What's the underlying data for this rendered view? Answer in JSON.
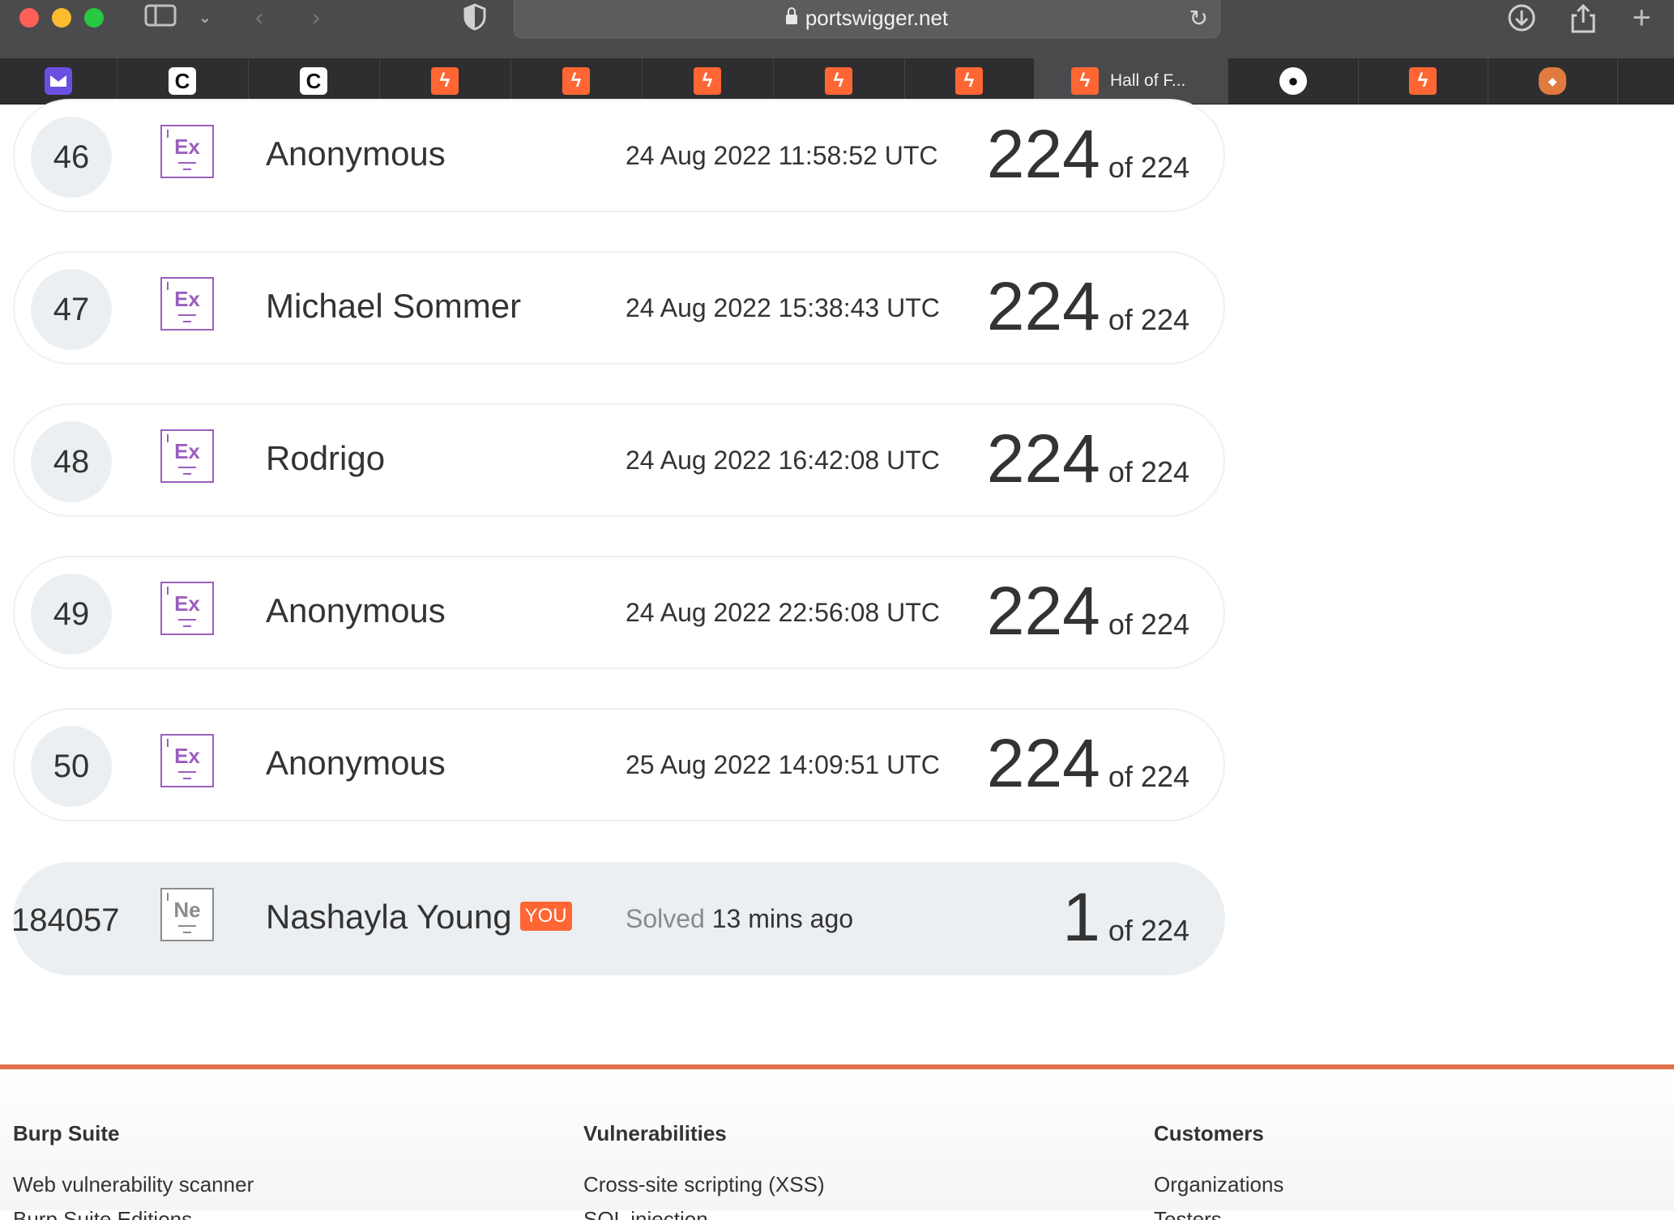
{
  "browser": {
    "url": "portswigger.net",
    "tabs": [
      {
        "icon": "mail-icon",
        "title": ""
      },
      {
        "icon": "c-logo-icon",
        "title": ""
      },
      {
        "icon": "c-logo-icon",
        "title": ""
      },
      {
        "icon": "burp-bolt-icon",
        "title": ""
      },
      {
        "icon": "burp-bolt-icon",
        "title": ""
      },
      {
        "icon": "burp-bolt-icon",
        "title": ""
      },
      {
        "icon": "burp-bolt-icon",
        "title": ""
      },
      {
        "icon": "burp-bolt-icon",
        "title": ""
      },
      {
        "icon": "burp-bolt-icon",
        "title": "Hall of F..."
      },
      {
        "icon": "github-icon",
        "title": ""
      },
      {
        "icon": "burp-bolt-icon",
        "title": ""
      },
      {
        "icon": "shield-extension-icon",
        "title": ""
      }
    ]
  },
  "leaderboard": {
    "rows": [
      {
        "rank": "46",
        "badge": "Ex",
        "name": "Anonymous",
        "date": "24 Aug 2022 11:58:52 UTC",
        "score": "224",
        "total": "of 224"
      },
      {
        "rank": "47",
        "badge": "Ex",
        "name": "Michael Sommer",
        "date": "24 Aug 2022 15:38:43 UTC",
        "score": "224",
        "total": "of 224"
      },
      {
        "rank": "48",
        "badge": "Ex",
        "name": "Rodrigo",
        "date": "24 Aug 2022 16:42:08 UTC",
        "score": "224",
        "total": "of 224"
      },
      {
        "rank": "49",
        "badge": "Ex",
        "name": "Anonymous",
        "date": "24 Aug 2022 22:56:08 UTC",
        "score": "224",
        "total": "of 224"
      },
      {
        "rank": "50",
        "badge": "Ex",
        "name": "Anonymous",
        "date": "25 Aug 2022 14:09:51 UTC",
        "score": "224",
        "total": "of 224"
      }
    ],
    "you": {
      "rank": "184057",
      "badge": "Ne",
      "name": "Nashayla Young",
      "tag": "YOU",
      "solved_label": "Solved",
      "solved_time": "13 mins ago",
      "score": "1",
      "total": "of 224"
    }
  },
  "footer": {
    "columns": [
      {
        "heading": "Burp Suite",
        "link": "Web vulnerability scanner",
        "link2": "Burp Suite Editions"
      },
      {
        "heading": "Vulnerabilities",
        "link": "Cross-site scripting (XSS)",
        "link2": "SQL injection"
      },
      {
        "heading": "Customers",
        "link": "Organizations",
        "link2": "Testers"
      }
    ]
  },
  "colors": {
    "accent": "#ff6633",
    "expert_badge": "#9b5fbd",
    "row_highlight": "#eceff2"
  }
}
